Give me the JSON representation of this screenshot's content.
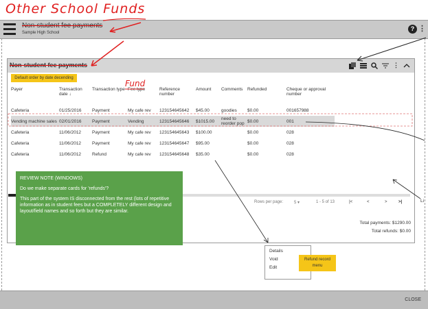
{
  "annotations": {
    "title_handwritten": "Other School Funds",
    "fund_handwritten": "Fund"
  },
  "app": {
    "title": "Non-student fee payments",
    "subtitle": "Sample High School"
  },
  "card": {
    "title": "Non-student fee payments",
    "default_order_label": "Default order by date decending"
  },
  "table": {
    "columns": [
      "Payer",
      "Transaction date",
      "Transaction type",
      "Fee type",
      "Reference number",
      "Amount",
      "Comments",
      "Refunded",
      "Cheque or approval number"
    ],
    "rows": [
      [
        "Cafeteria",
        "01/25/2016",
        "Payment",
        "My cafe rev",
        "123154645642",
        "$45.00",
        "goodies",
        "$0.00",
        "001657988"
      ],
      [
        "Vending machine sales",
        "02/01/2016",
        "Payment",
        "Vending",
        "123154645646",
        "$1015.00",
        "need to reorder pop",
        "$0.00",
        "001"
      ],
      [
        "Cafeteria",
        "11/06/2012",
        "Payment",
        "My cafe rev",
        "123154645643",
        "$100.00",
        "",
        "$0.00",
        "028"
      ],
      [
        "Cafeteria",
        "11/06/2012",
        "Payment",
        "My cafe rev",
        "123154645647",
        "$95.00",
        "",
        "$0.00",
        "028"
      ],
      [
        "Cafeteria",
        "11/06/2012",
        "Refund",
        "My cafe rev",
        "123154645648",
        "$35.00",
        "",
        "$0.00",
        "028"
      ]
    ]
  },
  "pagination": {
    "rows_per_page_label": "Rows per page:",
    "rows_per_page_value": "5",
    "range": "1 - 5 of 13"
  },
  "totals": {
    "payments": "Total payments: $1290.00",
    "refunds": "Total refunds: $0.00"
  },
  "review_note": {
    "heading": "REVIEW  NOTE (WINDOWS)",
    "question": "Do we make separate cards for 'refunds'?",
    "body": "This part of the system IS disconnected from the rest (lots of repetitive information as in student fees but a COMPLETELY different design and layout/field names and so forth but they are similar."
  },
  "context_menu": {
    "items": [
      "Details",
      "Void",
      "Edit"
    ],
    "note": "Refund record menu"
  },
  "side_label": "Li",
  "footer": {
    "close_label": "CLOSE"
  },
  "colors": {
    "annotation_red": "#e02020",
    "sticky_yellow": "#f5c518",
    "review_green": "#5aa14a"
  }
}
